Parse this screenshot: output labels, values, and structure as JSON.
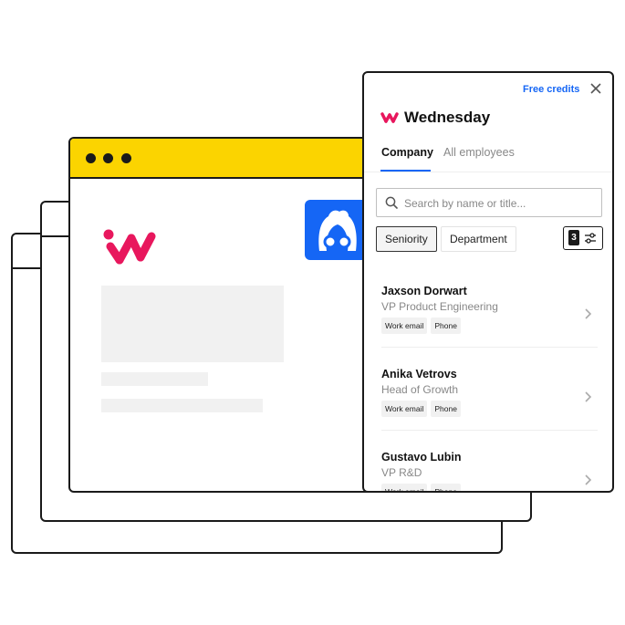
{
  "panel": {
    "free_credits": "Free credits",
    "brand_name": "Wednesday",
    "tabs": [
      {
        "label": "Company",
        "active": true
      },
      {
        "label": "All employees",
        "active": false
      }
    ],
    "search": {
      "placeholder": "Search by name or title..."
    },
    "filters": [
      {
        "label": "Seniority",
        "selected": true
      },
      {
        "label": "Department",
        "selected": false
      }
    ],
    "filter_count": "3",
    "people": [
      {
        "name": "Jaxson Dorwart",
        "title": "VP Product Engineering",
        "tags": [
          "Work email",
          "Phone"
        ]
      },
      {
        "name": "Anika Vetrovs",
        "title": "Head of Growth",
        "tags": [
          "Work email",
          "Phone"
        ]
      },
      {
        "name": "Gustavo Lubin",
        "title": "VP R&D",
        "tags": [
          "Work email",
          "Phone"
        ]
      }
    ]
  },
  "colors": {
    "brand_pink": "#e8175d",
    "accent_blue": "#1566f5",
    "titlebar_yellow": "#fbd400",
    "ink": "#1a1a1a"
  },
  "icons": [
    "wednesday-logo-icon",
    "close-icon",
    "search-icon",
    "sliders-icon",
    "chevron-right-icon",
    "avatar-glasses-icon"
  ]
}
